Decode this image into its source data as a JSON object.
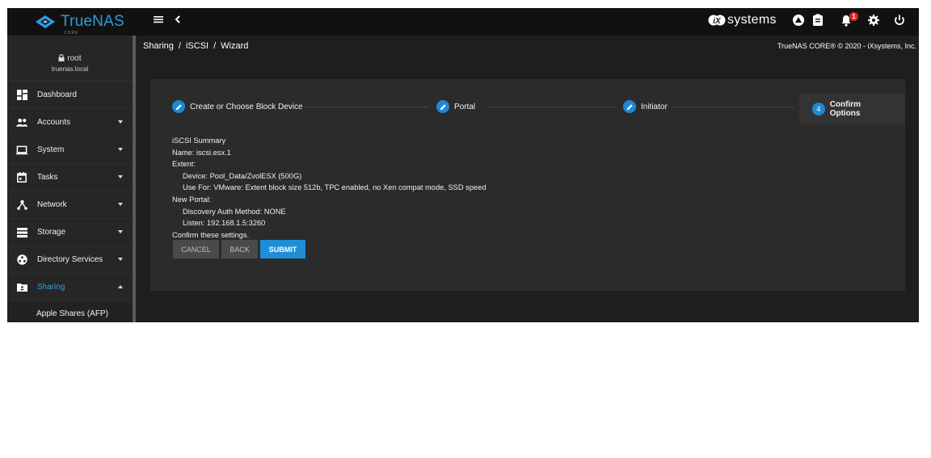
{
  "topbar": {
    "brand": "TrueNAS",
    "brand_sub": "CORE",
    "ix_word": "systems",
    "notification_count": "1"
  },
  "user": {
    "name": "root",
    "host": "truenas.local"
  },
  "sidebar": {
    "items": [
      {
        "label": "Dashboard",
        "icon": "dashboard-icon",
        "expandable": false
      },
      {
        "label": "Accounts",
        "icon": "accounts-icon",
        "expandable": true
      },
      {
        "label": "System",
        "icon": "system-icon",
        "expandable": true
      },
      {
        "label": "Tasks",
        "icon": "tasks-icon",
        "expandable": true
      },
      {
        "label": "Network",
        "icon": "network-icon",
        "expandable": true
      },
      {
        "label": "Storage",
        "icon": "storage-icon",
        "expandable": true
      },
      {
        "label": "Directory Services",
        "icon": "directory-services-icon",
        "expandable": true
      },
      {
        "label": "Sharing",
        "icon": "sharing-icon",
        "expandable": true,
        "active": true
      }
    ],
    "subitem": "Apple Shares (AFP)",
    "active_color": "#2f9fe3"
  },
  "breadcrumb": [
    "Sharing",
    "iSCSI",
    "Wizard"
  ],
  "copyright": "TrueNAS CORE® © 2020 - iXsystems, Inc.",
  "wizard": {
    "steps": [
      {
        "label": "Create or Choose Block Device",
        "icon": "pencil-icon"
      },
      {
        "label": "Portal",
        "icon": "pencil-icon"
      },
      {
        "label": "Initiator",
        "icon": "pencil-icon"
      },
      {
        "label": "Confirm Options",
        "number": "4",
        "active": true
      }
    ],
    "summary": {
      "title": "iSCSI Summary",
      "name": "Name: iscsi.esx.1",
      "extent": "Extent:",
      "device": "Device: Pool_Data/ZvolESX (500G)",
      "use_for": "Use For: VMware: Extent block size 512b, TPC enabled, no Xen compat mode, SSD speed",
      "new_portal": "New Portal:",
      "auth": "Discovery Auth Method: NONE",
      "listen": "Listen: 192.168.1.5:3260",
      "confirm": "Confirm these settings."
    },
    "buttons": {
      "cancel": "CANCEL",
      "back": "BACK",
      "submit": "SUBMIT"
    },
    "accent": "#1e8fd6"
  }
}
